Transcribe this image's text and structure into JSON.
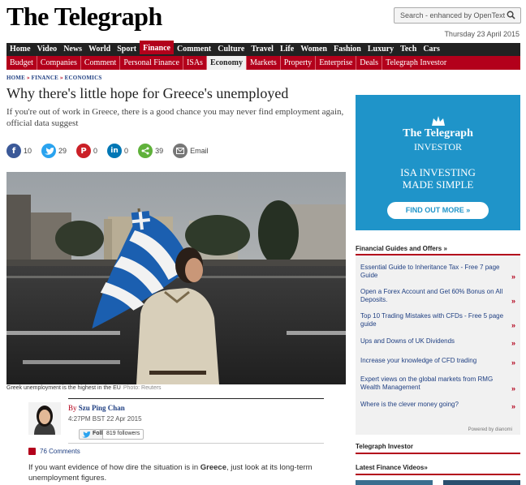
{
  "header": {
    "logo": "The Telegraph",
    "search_placeholder": "Search - enhanced by OpenText",
    "date": "Thursday 23 April 2015"
  },
  "nav_primary": [
    {
      "label": "Home"
    },
    {
      "label": "Video"
    },
    {
      "label": "News"
    },
    {
      "label": "World"
    },
    {
      "label": "Sport"
    },
    {
      "label": "Finance",
      "active": true
    },
    {
      "label": "Comment"
    },
    {
      "label": "Culture"
    },
    {
      "label": "Travel"
    },
    {
      "label": "Life"
    },
    {
      "label": "Women"
    },
    {
      "label": "Fashion"
    },
    {
      "label": "Luxury"
    },
    {
      "label": "Tech"
    },
    {
      "label": "Cars"
    }
  ],
  "nav_secondary": [
    {
      "label": "Budget"
    },
    {
      "label": "Companies"
    },
    {
      "label": "Comment"
    },
    {
      "label": "Personal Finance"
    },
    {
      "label": "ISAs"
    },
    {
      "label": "Economy",
      "active": true
    },
    {
      "label": "Markets"
    },
    {
      "label": "Property"
    },
    {
      "label": "Enterprise"
    },
    {
      "label": "Deals"
    },
    {
      "label": "Telegraph Investor"
    }
  ],
  "breadcrumb": {
    "home": "HOME",
    "finance": "FINANCE",
    "economics": "ECONOMICS"
  },
  "article": {
    "headline": "Why there's little hope for Greece's unemployed",
    "standfirst": "If you're out of work in Greece, there is a good chance you may never find employment again, official data suggest",
    "caption": "Greek unemployment is the highest in the EU",
    "credit": "Photo: Reuters",
    "author_prefix": "By",
    "author": "Szu Ping Chan",
    "timestamp": "4:27PM BST 22 Apr 2015",
    "follow_label": "Follow",
    "followers": "819 followers",
    "comments": "76 Comments",
    "body_before": "If you want evidence of how dire the situation is in ",
    "body_bold": "Greece",
    "body_after": ", just look at its long-term unemployment figures."
  },
  "share": {
    "facebook": "10",
    "twitter": "29",
    "pinterest": "0",
    "linkedin": "0",
    "share": "39",
    "email": "Email"
  },
  "ad": {
    "brand": "The Telegraph",
    "sub": "INVESTOR",
    "line1": "ISA INVESTING",
    "line2": "MADE SIMPLE",
    "cta": "FIND OUT MORE »",
    "color": "#1f94c9"
  },
  "financial_guides": {
    "title": "Financial Guides and Offers »",
    "items": [
      "Essential Guide to Inheritance Tax - Free 7 page Guide",
      "Open a Forex Account and Get 60% Bonus on All Deposits.",
      "Top 10 Trading Mistakes with CFDs - Free 5 page guide",
      "Ups and Downs of UK Dividends",
      "Increase your knowledge of CFD trading",
      "Expert views on the global markets from RMG Wealth Management",
      "Where is the clever money going?"
    ],
    "arrow": "»",
    "powered": "Powered by dianomi"
  },
  "sidebar": {
    "investor_title": "Telegraph Investor",
    "videos_title": "Latest Finance Videos»"
  },
  "colors": {
    "brand_red": "#b3001b",
    "link_blue": "#1f3f82",
    "nav_dark": "#222222"
  }
}
